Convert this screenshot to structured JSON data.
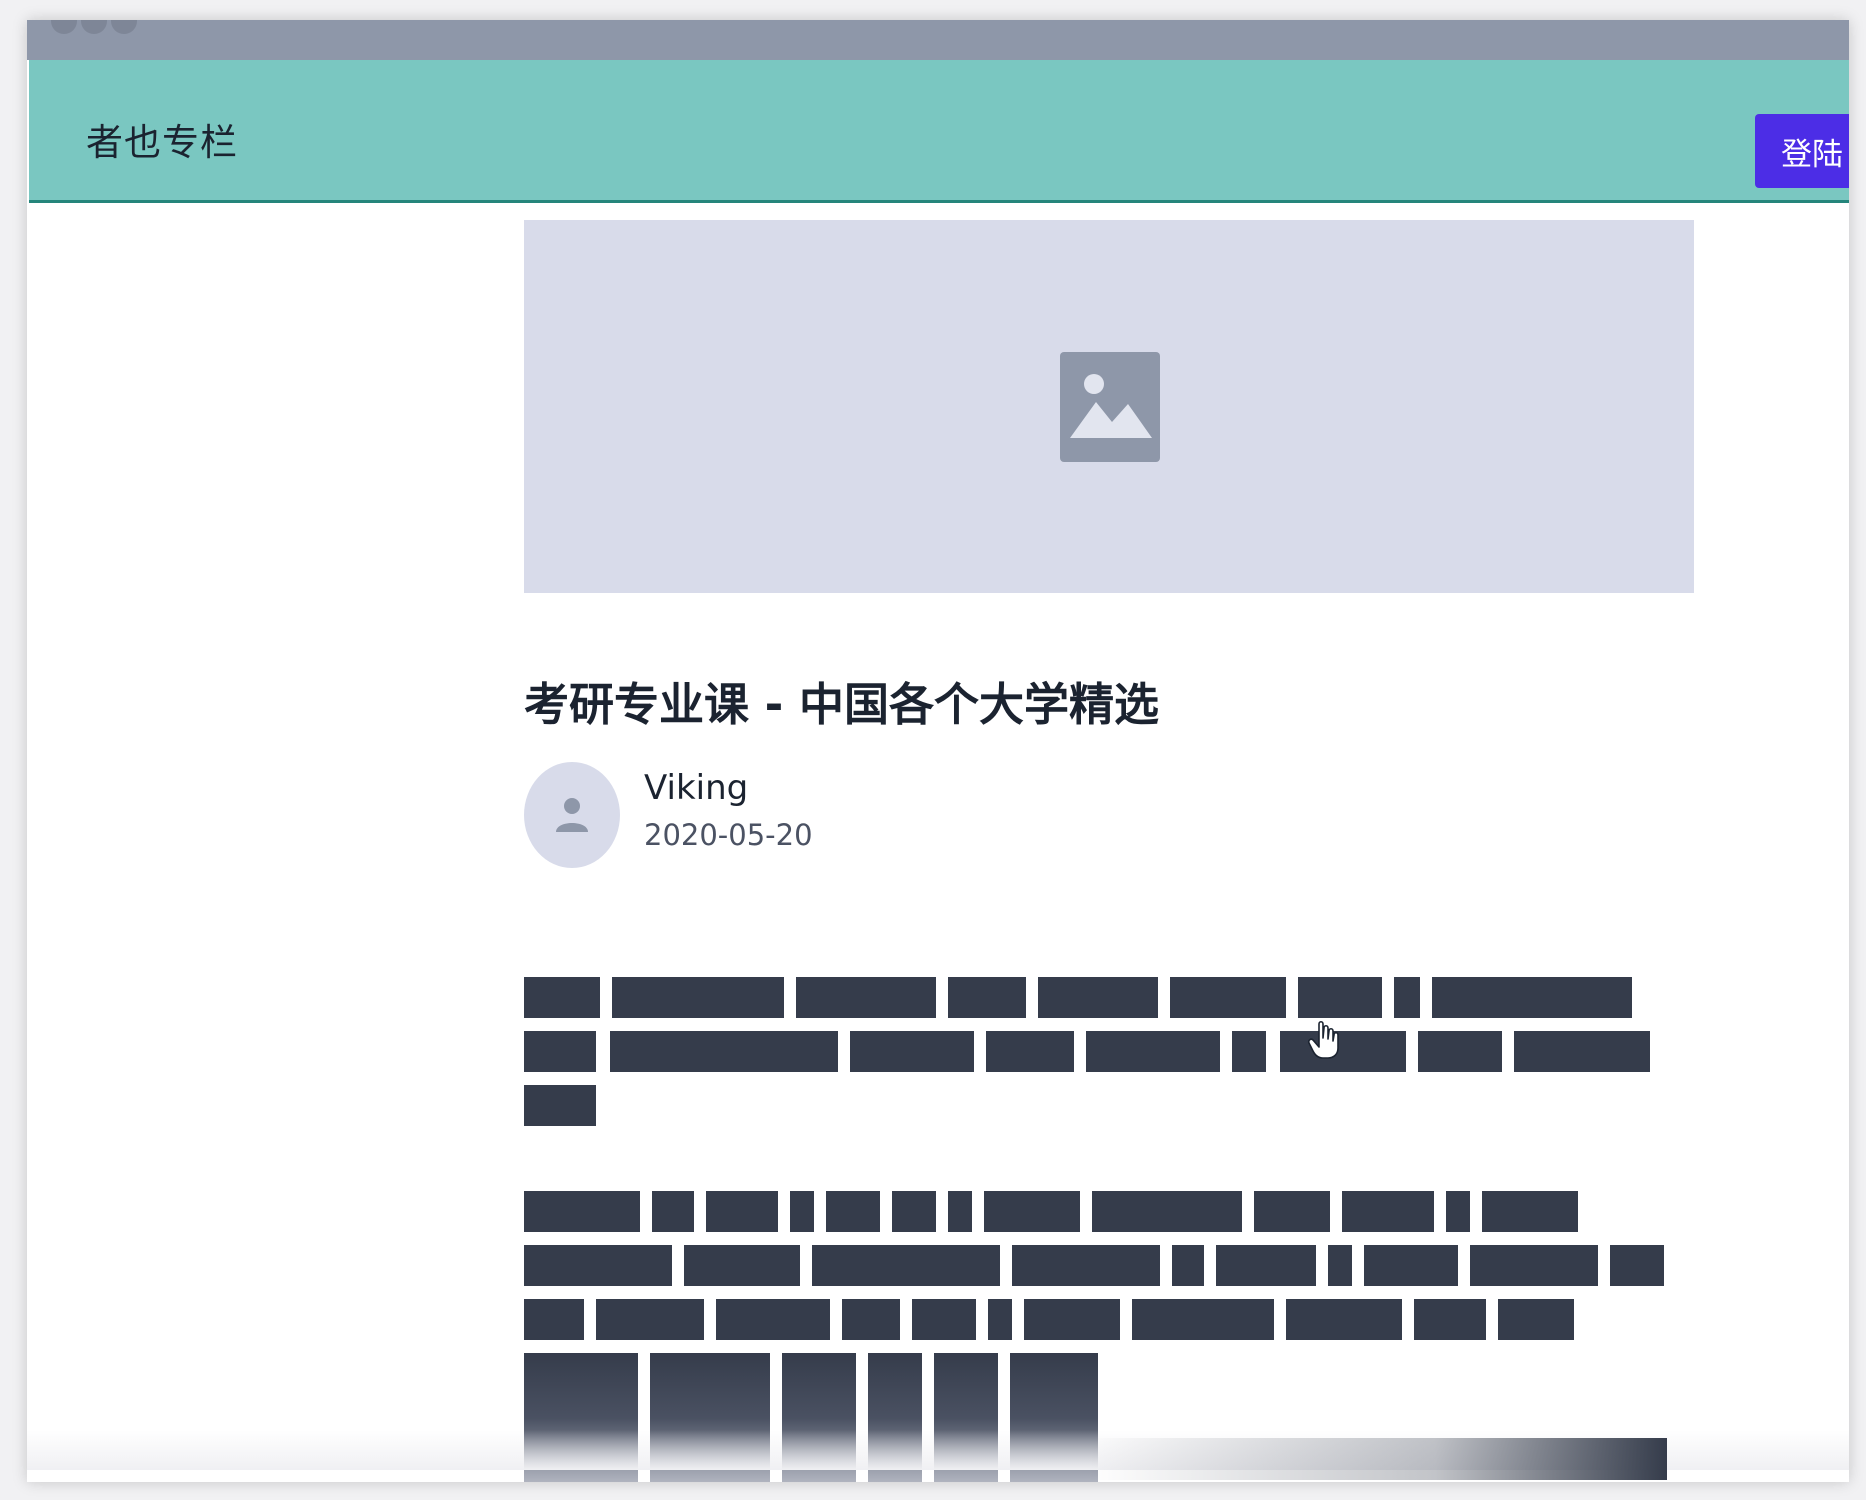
{
  "navbar": {
    "brand": "者也专栏",
    "login_label": "登陆"
  },
  "hero": {
    "icon": "image-placeholder-icon"
  },
  "article": {
    "title": "考研专业课 - 中国各个大学精选",
    "author": {
      "name": "Viking",
      "avatar_icon": "user-icon"
    },
    "date": "2020-05-20"
  },
  "colors": {
    "navbar_bg": "#7ac7c1",
    "login_button": "#4c2de6",
    "placeholder_bg": "#d8dbea",
    "text_block": "#353c4b"
  }
}
